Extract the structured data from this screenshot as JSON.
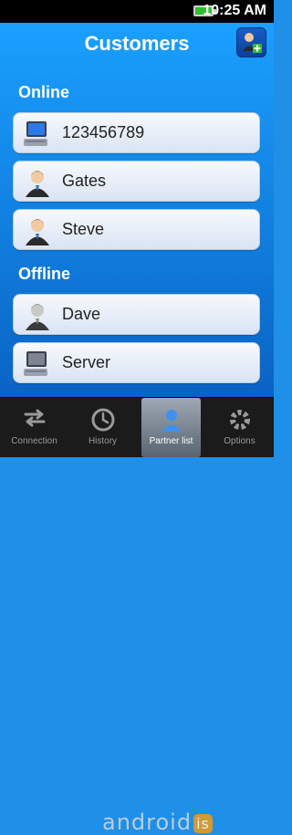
{
  "status": {
    "time": "10:25 AM"
  },
  "header": {
    "title": "Customers"
  },
  "sections": [
    {
      "label": "Online",
      "items": [
        {
          "label": "123456789",
          "icon": "computer-icon"
        },
        {
          "label": "Gates",
          "icon": "person-icon"
        },
        {
          "label": "Steve",
          "icon": "person-icon"
        }
      ]
    },
    {
      "label": "Offline",
      "items": [
        {
          "label": "Dave",
          "icon": "person-icon"
        },
        {
          "label": "Server",
          "icon": "computer-icon"
        }
      ]
    }
  ],
  "tabs": [
    {
      "label": "Connection",
      "icon": "arrows-icon",
      "active": false
    },
    {
      "label": "History",
      "icon": "history-icon",
      "active": false
    },
    {
      "label": "Partner list",
      "icon": "person-icon",
      "active": true
    },
    {
      "label": "Options",
      "icon": "gear-icon",
      "active": false
    }
  ],
  "watermark": {
    "text": "android",
    "badge": "is"
  },
  "colors": {
    "accent": "#1aa0ff",
    "tabbar": "#1b1b1b",
    "active_tab": "#7f8a96"
  }
}
